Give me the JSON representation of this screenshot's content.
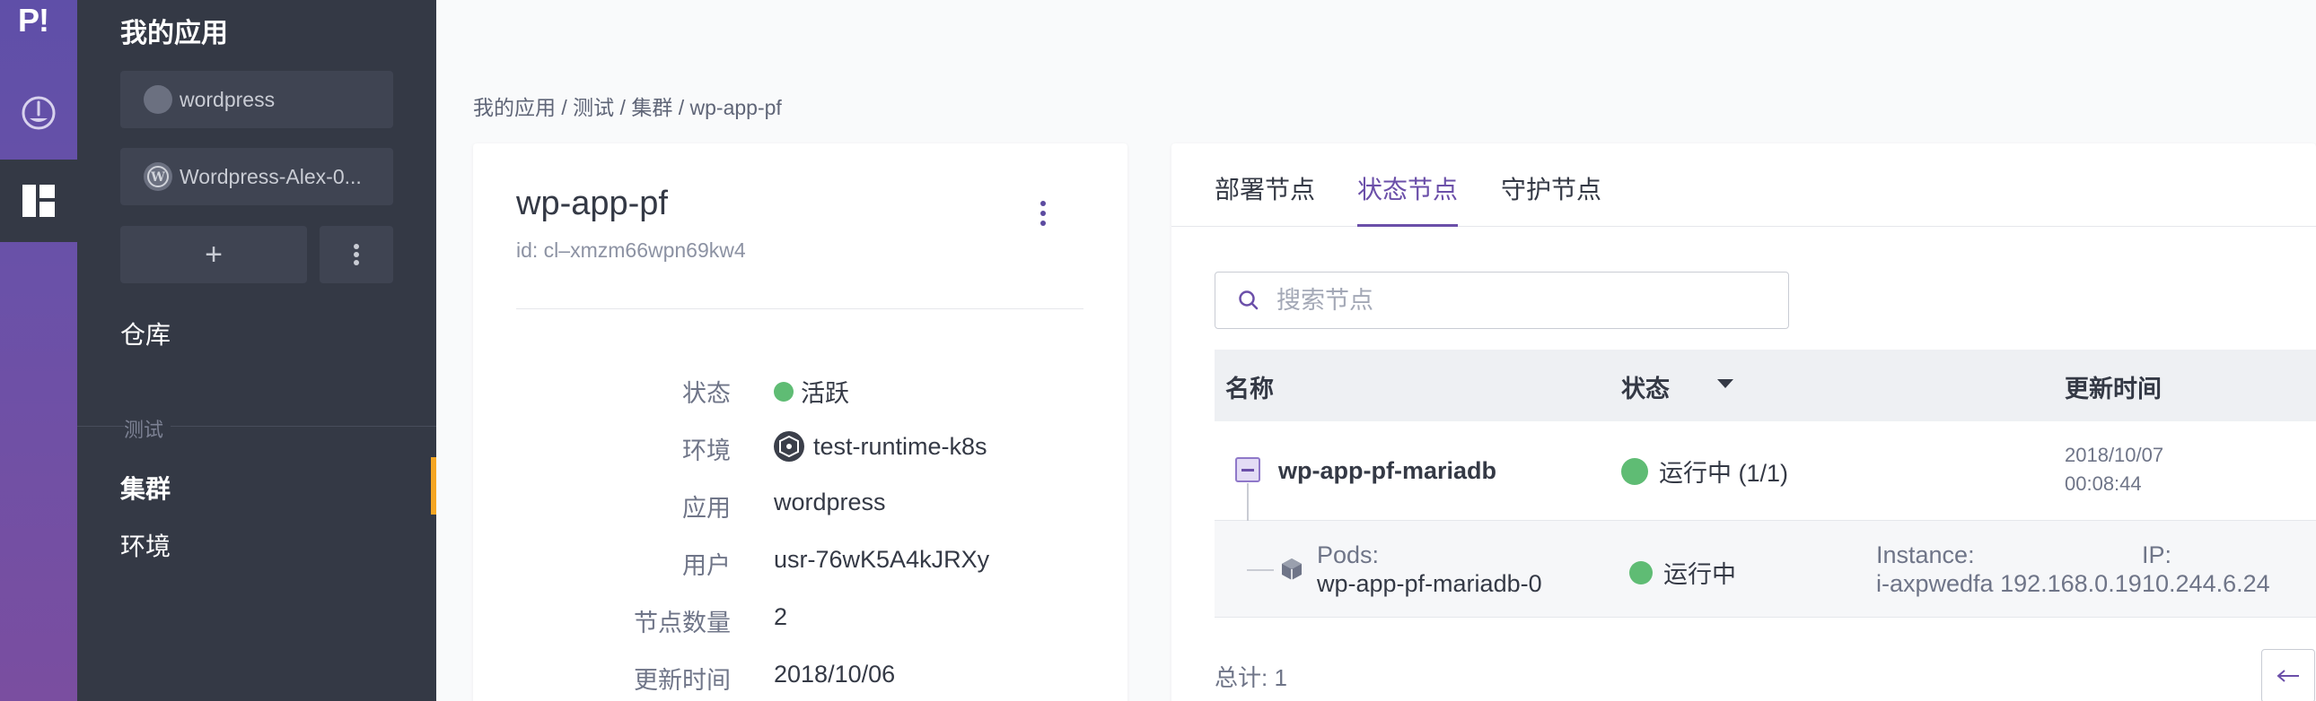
{
  "rail": {
    "logo": "P!"
  },
  "sidebar": {
    "title": "我的应用",
    "apps": [
      {
        "label": "wordpress"
      },
      {
        "label": "Wordpress-Alex-0..."
      }
    ],
    "add_label": "+",
    "store_label": "仓库",
    "section_label": "测试",
    "nav_cluster": "集群",
    "nav_env": "环境"
  },
  "breadcrumb": "我的应用 / 测试 / 集群 / wp-app-pf",
  "cluster": {
    "name": "wp-app-pf",
    "id": "id: cl–xmzm66wpn69kw4",
    "fields": [
      {
        "label": "状态",
        "value": "活跃"
      },
      {
        "label": "环境",
        "value": "test-runtime-k8s"
      },
      {
        "label": "应用",
        "value": "wordpress"
      },
      {
        "label": "用户",
        "value": "usr-76wK5A4kJRXy"
      },
      {
        "label": "节点数量",
        "value": "2"
      },
      {
        "label": "更新时间",
        "value": "2018/10/06"
      }
    ]
  },
  "tabs": [
    "部署节点",
    "状态节点",
    "守护节点"
  ],
  "search": {
    "placeholder": "搜索节点"
  },
  "table": {
    "headers": {
      "name": "名称",
      "status": "状态",
      "updated": "更新时间"
    },
    "row": {
      "name": "wp-app-pf-mariadb",
      "status": "运行中 (1/1)",
      "updated_date": "2018/10/07",
      "updated_time": "00:08:44"
    },
    "pod": {
      "pods_label": "Pods:",
      "pod_name": "wp-app-pf-mariadb-0",
      "status": "运行中",
      "instance_label": "Instance:",
      "instance_value": "i-axpwedfa 192.168.0.19",
      "ip_label": "IP:",
      "ip_value": "10.244.6.24"
    }
  },
  "total": "总计: 1",
  "colors": {
    "accent": "#6b4fa9",
    "running": "#5fbc74",
    "sidebar": "#343945",
    "active_marker": "#f5a623"
  }
}
